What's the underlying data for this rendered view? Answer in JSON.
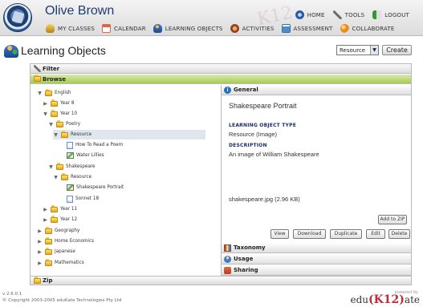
{
  "header": {
    "user_name": "Olive Brown",
    "top_menu": [
      {
        "label": "HOME",
        "icon": "home-icon"
      },
      {
        "label": "TOOLS",
        "icon": "tools-icon"
      },
      {
        "label": "LOGOUT",
        "icon": "logout-icon"
      }
    ],
    "nav": [
      {
        "label": "MY CLASSES",
        "icon": "classes-icon"
      },
      {
        "label": "CALENDAR",
        "icon": "calendar-icon"
      },
      {
        "label": "LEARNING OBJECTS",
        "icon": "objects-icon"
      },
      {
        "label": "ACTIVITIES",
        "icon": "activities-icon"
      },
      {
        "label": "ASSESSMENT",
        "icon": "assessment-icon"
      },
      {
        "label": "COLLABORATE",
        "icon": "collab-icon"
      }
    ]
  },
  "page": {
    "title": "Learning Objects",
    "resource_select": "Resource",
    "create_button": "Create"
  },
  "panels": {
    "filter": "Filter",
    "browse": "Browse",
    "zip": "Zip"
  },
  "tree": [
    {
      "label": "English",
      "state": "expanded",
      "icon": "folder-icon"
    },
    {
      "label": "Year 8",
      "state": "collapsed",
      "icon": "folder-icon"
    },
    {
      "label": "Year 10",
      "state": "expanded",
      "icon": "folder-icon"
    },
    {
      "label": "Poetry",
      "state": "expanded",
      "icon": "folder-icon"
    },
    {
      "label": "Resource",
      "state": "expanded",
      "icon": "folder-icon"
    },
    {
      "label": "How To Read a Poem",
      "state": "",
      "icon": "doc-icon"
    },
    {
      "label": "Water Lillies",
      "state": "",
      "icon": "image-icon"
    },
    {
      "label": "Shakespeare",
      "state": "expanded",
      "icon": "folder-icon"
    },
    {
      "label": "Resource",
      "state": "expanded",
      "icon": "folder-icon"
    },
    {
      "label": "Shakespeare Portrait",
      "state": "",
      "icon": "image-icon"
    },
    {
      "label": "Sonnet 18",
      "state": "",
      "icon": "doc-icon"
    },
    {
      "label": "Year 11",
      "state": "collapsed",
      "icon": "folder-icon"
    },
    {
      "label": "Year 12",
      "state": "collapsed",
      "icon": "folder-icon"
    },
    {
      "label": "Geography",
      "state": "collapsed",
      "icon": "folder-icon"
    },
    {
      "label": "Home Economics",
      "state": "collapsed",
      "icon": "folder-icon"
    },
    {
      "label": "Japanese",
      "state": "collapsed",
      "icon": "folder-icon"
    },
    {
      "label": "Mathematics",
      "state": "collapsed",
      "icon": "folder-icon"
    }
  ],
  "details": {
    "general": "General",
    "title": "Shakespeare Portrait",
    "type_label": "LEARNING OBJECT TYPE",
    "type_value": "Resource (Image)",
    "description_label": "DESCRIPTION",
    "description_value": "An image of William Shakespeare",
    "file": "shakespeare.jpg (2.96 KB)",
    "add_to_zip": "Add to ZIP",
    "actions": [
      "View",
      "Download",
      "Duplicate",
      "Edit",
      "Delete"
    ],
    "taxonomy": "Taxonomy",
    "usage": "Usage",
    "sharing": "Sharing"
  },
  "footer": {
    "version": "v 2.6.0.1",
    "copyright": "© Copyright 2003-2005 eduKate Technologies Pty Ltd",
    "powered_by": "powered by",
    "brand": "edu(K12)ate"
  }
}
